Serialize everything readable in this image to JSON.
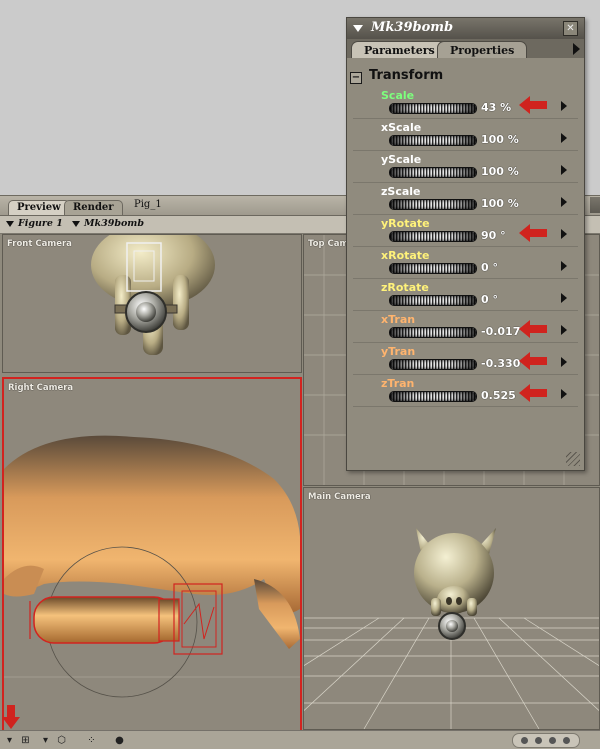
{
  "document_window": {
    "tabs": [
      {
        "label": "Preview",
        "active": true
      },
      {
        "label": "Render",
        "active": false
      }
    ],
    "document_title": "Pig_1",
    "figure_selector": "Figure 1",
    "actor_selector": "Mk39bomb",
    "viewports": {
      "front": "Front Camera",
      "top": "Top Camera",
      "right": "Right Camera",
      "main": "Main Camera"
    }
  },
  "palette": {
    "title": "Mk39bomb",
    "tabs": [
      {
        "label": "Parameters",
        "active": true
      },
      {
        "label": "Properties",
        "active": false
      }
    ],
    "group_toggle": "−",
    "group_title": "Transform",
    "params": [
      {
        "name": "Scale",
        "value": "43 %",
        "color": "#7dff7d",
        "highlighted": true
      },
      {
        "name": "xScale",
        "value": "100 %",
        "color": "#ffffff",
        "highlighted": false
      },
      {
        "name": "yScale",
        "value": "100 %",
        "color": "#ffffff",
        "highlighted": false
      },
      {
        "name": "zScale",
        "value": "100 %",
        "color": "#ffffff",
        "highlighted": false
      },
      {
        "name": "yRotate",
        "value": "90 °",
        "color": "#fff27a",
        "highlighted": true
      },
      {
        "name": "xRotate",
        "value": "0 °",
        "color": "#fff27a",
        "highlighted": false
      },
      {
        "name": "zRotate",
        "value": "0 °",
        "color": "#fff27a",
        "highlighted": false
      },
      {
        "name": "xTran",
        "value": "-0.017",
        "color": "#ffb46e",
        "highlighted": true
      },
      {
        "name": "yTran",
        "value": "-0.330",
        "color": "#ffb46e",
        "highlighted": true
      },
      {
        "name": "zTran",
        "value": "0.525",
        "color": "#ffb46e",
        "highlighted": true
      }
    ]
  },
  "colors": {
    "highlight_arrow": "#d0231e",
    "active_viewport_border": "#d2231f"
  }
}
